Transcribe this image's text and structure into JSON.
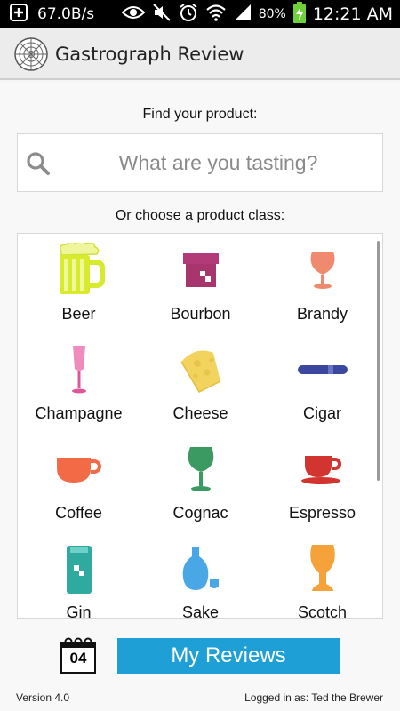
{
  "status_bar": {
    "speed": "67.0B/s",
    "battery": "80%",
    "time": "12:21 AM",
    "icons": [
      "download-icon",
      "eye-icon",
      "mute-icon",
      "alarm-icon",
      "wifi-icon",
      "signal-icon",
      "battery-charging-icon"
    ]
  },
  "header": {
    "title": "Gastrograph Review",
    "logo_icon": "radar-web-icon"
  },
  "search": {
    "label": "Find your product:",
    "placeholder": "What are you tasting?",
    "value": ""
  },
  "products": {
    "label": "Or choose a product class:",
    "items": [
      {
        "label": "Beer",
        "icon": "beer-mug-icon",
        "color": "#d7ea2c"
      },
      {
        "label": "Bourbon",
        "icon": "bourbon-barrel-icon",
        "color": "#a8356e"
      },
      {
        "label": "Brandy",
        "icon": "brandy-glass-icon",
        "color": "#f08a6e"
      },
      {
        "label": "Champagne",
        "icon": "champagne-flute-icon",
        "color": "#e0559a"
      },
      {
        "label": "Cheese",
        "icon": "cheese-icon",
        "color": "#f2d35e"
      },
      {
        "label": "Cigar",
        "icon": "cigar-icon",
        "color": "#3c47a0"
      },
      {
        "label": "Coffee",
        "icon": "coffee-cup-icon",
        "color": "#f26a46"
      },
      {
        "label": "Cognac",
        "icon": "cognac-glass-icon",
        "color": "#3a9a62"
      },
      {
        "label": "Espresso",
        "icon": "espresso-cup-icon",
        "color": "#d2342f"
      },
      {
        "label": "Gin",
        "icon": "gin-bottle-icon",
        "color": "#2faa9e"
      },
      {
        "label": "Sake",
        "icon": "sake-bottle-icon",
        "color": "#4aa7e6"
      },
      {
        "label": "Scotch",
        "icon": "scotch-glass-icon",
        "color": "#f5a23a"
      }
    ]
  },
  "footer": {
    "calendar_day": "04",
    "my_reviews_label": "My Reviews",
    "version": "Version 4.0",
    "logged_in": "Logged in as: Ted the Brewer",
    "button_color": "#1e9fd6"
  }
}
